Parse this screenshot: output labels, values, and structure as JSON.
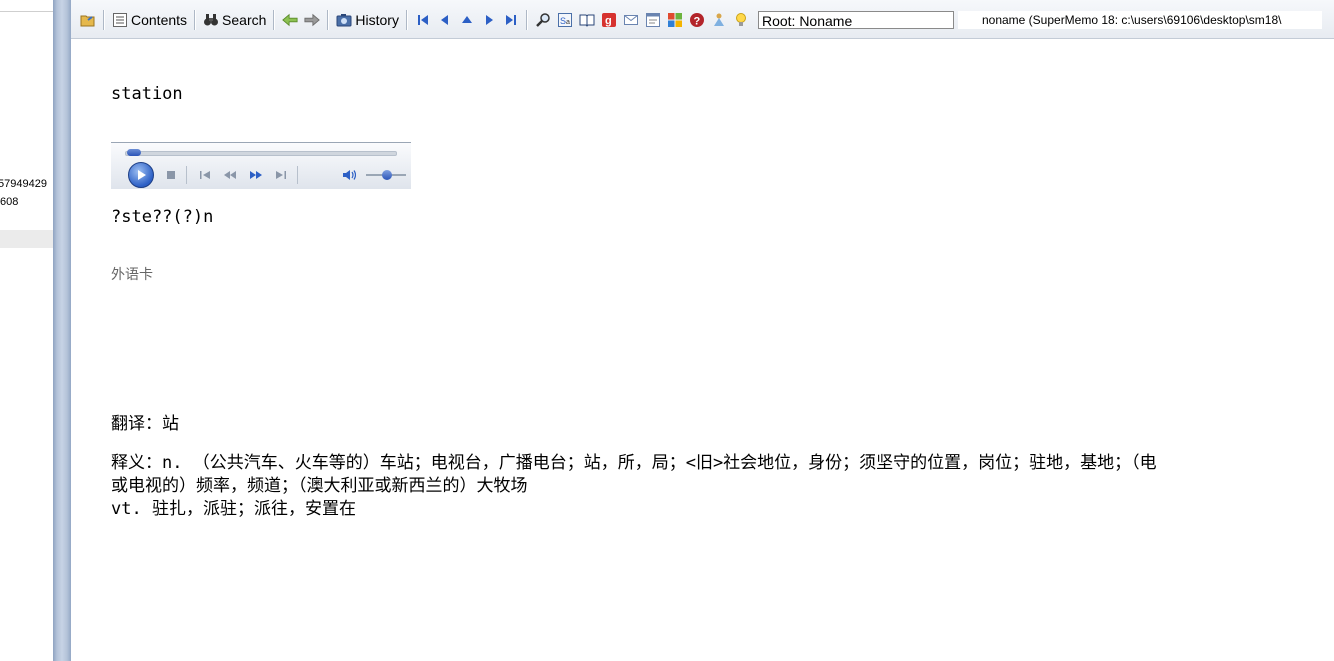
{
  "left_panel": {
    "line1": "57949429",
    "line2": "608"
  },
  "toolbar": {
    "contents_label": "Contents",
    "search_label": "Search",
    "history_label": "History",
    "root_field": "Root: Noname",
    "status_text": "noname (SuperMemo 18: c:\\users\\69106\\desktop\\sm18\\"
  },
  "card": {
    "word": "station",
    "pronunciation": "?ste??(?)n",
    "card_type": "外语卡",
    "translation": "翻译：站",
    "definition_line1": "释义：n. （公共汽车、火车等的）车站；电视台，广播电台；站，所，局；<旧>社会地位，身份；须坚守的位置，岗位；驻地，基地；（电",
    "definition_line2": "或电视的）频率，频道；（澳大利亚或新西兰的）大牧场",
    "definition_line3": "vt. 驻扎，派驻；派往，安置在"
  },
  "player": {
    "progress": 0.0,
    "volume": 0.5
  },
  "colors": {
    "splitter": "#b4c3d9",
    "toolbar_bg": "#eef1f6",
    "accent_blue": "#2c5fc5"
  }
}
